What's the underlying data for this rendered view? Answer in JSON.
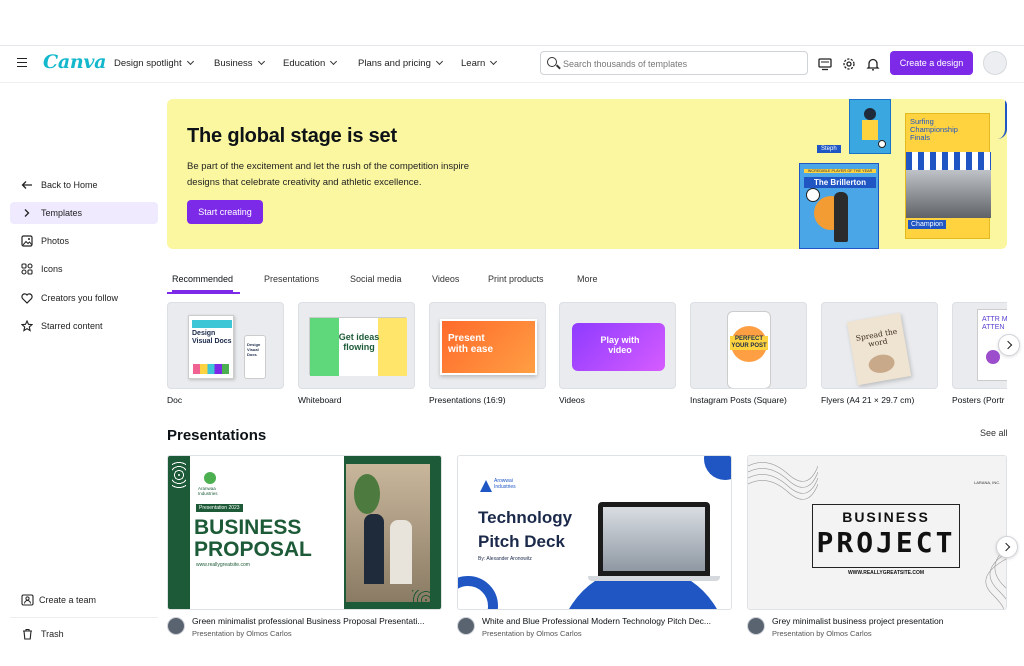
{
  "app": {
    "logo": "Canva"
  },
  "nav": [
    {
      "label": "Design spotlight"
    },
    {
      "label": "Business"
    },
    {
      "label": "Education"
    },
    {
      "label": "Plans and pricing"
    },
    {
      "label": "Learn"
    }
  ],
  "search": {
    "placeholder": "Search thousands of templates"
  },
  "header": {
    "create_label": "Create a design"
  },
  "sidebar": {
    "items": [
      {
        "label": "Back to Home",
        "icon": "arrow-left-icon"
      },
      {
        "label": "Templates",
        "icon": "chevron-right-icon",
        "active": true
      },
      {
        "label": "Photos",
        "icon": "image-icon"
      },
      {
        "label": "Icons",
        "icon": "shapes-icon"
      },
      {
        "label": "Creators you follow",
        "icon": "heart-icon"
      },
      {
        "label": "Starred content",
        "icon": "star-icon"
      }
    ],
    "bottom": [
      {
        "label": "Create a team",
        "icon": "team-icon"
      },
      {
        "label": "Trash",
        "icon": "trash-icon"
      }
    ]
  },
  "hero": {
    "title": "The global stage is set",
    "body": "Be part of the excitement and let the rush of the competition inspire designs that celebrate creativity and athletic excellence.",
    "button": "Start creating",
    "art": {
      "steph": "Steph",
      "brillerton_top": "INCREDIBLE PLAYER OF THE YEAR",
      "brillerton": "The Brillerton",
      "surfing": "Surfing Championship Finals",
      "champion": "Champion"
    }
  },
  "tabs": [
    {
      "label": "Recommended",
      "active": true
    },
    {
      "label": "Presentations"
    },
    {
      "label": "Social media"
    },
    {
      "label": "Videos"
    },
    {
      "label": "Print products"
    },
    {
      "label": "More"
    }
  ],
  "categories": [
    {
      "label": "Doc",
      "art": "Design Visual Docs",
      "art_small": "Design Visual Docs"
    },
    {
      "label": "Whiteboard",
      "art": "Get ideas flowing"
    },
    {
      "label": "Presentations (16:9)",
      "art": "Present with ease"
    },
    {
      "label": "Videos",
      "art": "Play with video"
    },
    {
      "label": "Instagram Posts (Square)",
      "art": "PERFECT YOUR POST"
    },
    {
      "label": "Flyers (A4 21 × 29.7 cm)",
      "art": "Spread the word"
    },
    {
      "label": "Posters (Portr",
      "art": "ATTR MO ATTEN"
    }
  ],
  "presentations": {
    "title": "Presentations",
    "see_all": "See all",
    "items": [
      {
        "title": "Green minimalist professional Business Proposal Presentati...",
        "subtitle": "Presentation by Olmos Carlos",
        "art": {
          "brand": "Aranwaa Industries",
          "tag": "Presentation 2023",
          "line1": "BUSINESS",
          "line2": "PROPOSAL",
          "url": "www.reallygreatsite.com"
        }
      },
      {
        "title": "White and Blue Professional Modern Technology Pitch Dec...",
        "subtitle": "Presentation by Olmos Carlos",
        "art": {
          "brand": "Arowwai Industries",
          "line1": "Technology",
          "line2": "Pitch Deck",
          "by": "By: Alexander Aronowitz"
        }
      },
      {
        "title": "Grey minimalist business project presentation",
        "subtitle": "Presentation by Olmos Carlos",
        "art": {
          "brand": "LARANA, INC.",
          "line1": "BUSINESS",
          "line2": "PROJECT",
          "url": "WWW.REALLYGREATSITE.COM"
        }
      }
    ]
  },
  "colors": {
    "accent": "#7d2ae8",
    "hero_bg": "#fbf7a0",
    "logo": "#13b8cd",
    "green": "#1d5b38",
    "navy": "#1b2a4a",
    "blue": "#1f56c4"
  }
}
